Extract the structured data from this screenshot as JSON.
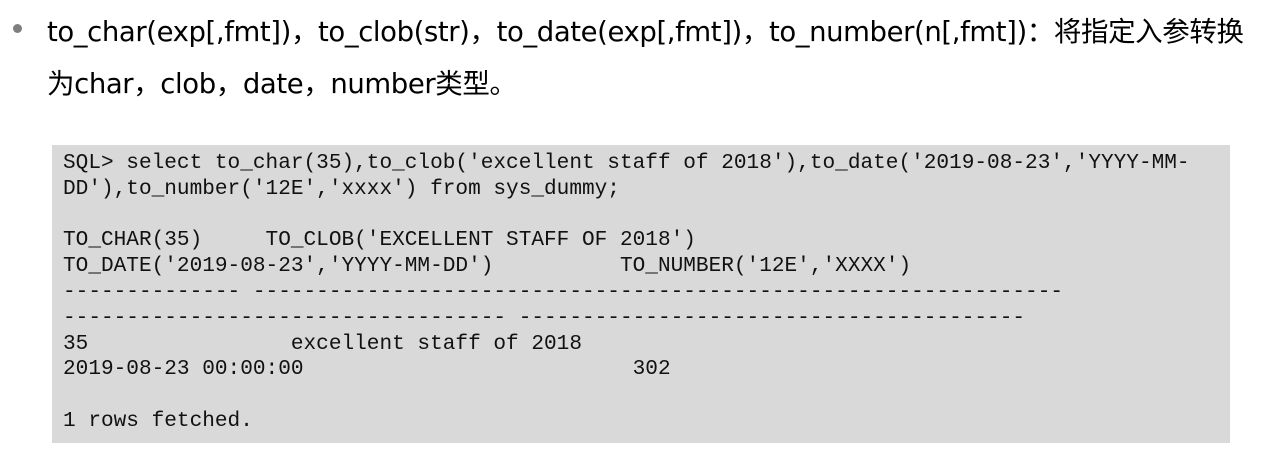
{
  "bullet": {
    "text": "to_char(exp[,fmt])，to_clob(str)，to_date(exp[,fmt])，to_number(n[,fmt])：将指定入参转换为char，clob，date，number类型。"
  },
  "code": {
    "lines": [
      "SQL> select to_char(35),to_clob('excellent staff of 2018'),to_date('2019-08-23','YYYY-MM-",
      "DD'),to_number('12E','xxxx') from sys_dummy;",
      "",
      "TO_CHAR(35)     TO_CLOB('EXCELLENT STAFF OF 2018')",
      "TO_DATE('2019-08-23','YYYY-MM-DD')          TO_NUMBER('12E','XXXX')",
      "-------------- ----------------------------------------------------------------",
      "----------------------------------- ----------------------------------------",
      "35                excellent staff of 2018",
      "2019-08-23 00:00:00                          302",
      "",
      "1 rows fetched."
    ]
  }
}
